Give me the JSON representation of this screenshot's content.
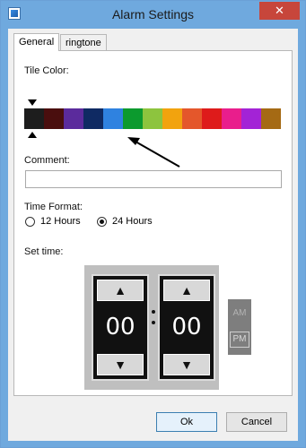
{
  "window": {
    "title": "Alarm Settings",
    "close_glyph": "✕"
  },
  "tabs": [
    {
      "label": "General",
      "selected": true
    },
    {
      "label": "ringtone",
      "selected": false
    }
  ],
  "tile_color": {
    "label": "Tile Color:",
    "selected_index": 0,
    "swatches": [
      "#1d1d1d",
      "#4a0e0e",
      "#5b2b9c",
      "#0f2a63",
      "#2f82e0",
      "#0c9a2e",
      "#8dc43e",
      "#f2a30e",
      "#e4572b",
      "#de1b1b",
      "#e91e8c",
      "#a323d6",
      "#a56a14"
    ]
  },
  "comment": {
    "label": "Comment:",
    "value": "",
    "placeholder": ""
  },
  "time_format": {
    "label": "Time Format:",
    "options": [
      {
        "label": "12 Hours",
        "checked": false
      },
      {
        "label": "24 Hours",
        "checked": true
      }
    ]
  },
  "set_time": {
    "label": "Set time:",
    "hours": "00",
    "minutes": "00",
    "up_glyph": "▲",
    "down_glyph": "▼",
    "am_label": "AM",
    "pm_label": "PM"
  },
  "buttons": {
    "ok": "Ok",
    "cancel": "Cancel"
  },
  "colors": {
    "titlebar": "#6fa9de",
    "close": "#c7463b",
    "clock_bg": "#111111"
  },
  "icons": [
    "app-icon",
    "close-icon",
    "arrow-up-icon",
    "arrow-down-icon"
  ]
}
